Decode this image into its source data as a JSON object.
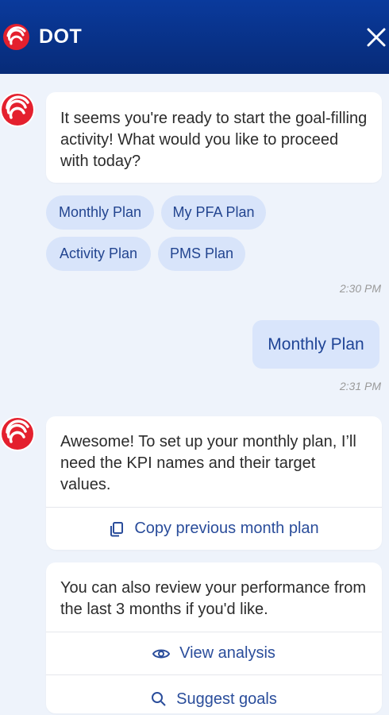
{
  "header": {
    "title": "DOT",
    "brand_color": "#0a3a9c",
    "logo_color": "#e4202e"
  },
  "messages": {
    "bot1": {
      "text": "It seems you're ready to start the goal-filling activity! What would you like to proceed with today?",
      "options": [
        "Monthly Plan",
        "My PFA Plan",
        "Activity Plan",
        "PMS Plan"
      ],
      "time": "2:30 PM"
    },
    "user1": {
      "text": "Monthly Plan",
      "time": "2:31 PM"
    },
    "bot2": {
      "text": "Awesome! To set up your monthly plan, I’ll need the KPI names and their target values.",
      "action": "Copy previous month plan"
    },
    "bot3": {
      "text": "You can also review your performance from the last 3 months if you'd like.",
      "action1": "View analysis",
      "action2": "Suggest goals"
    }
  }
}
